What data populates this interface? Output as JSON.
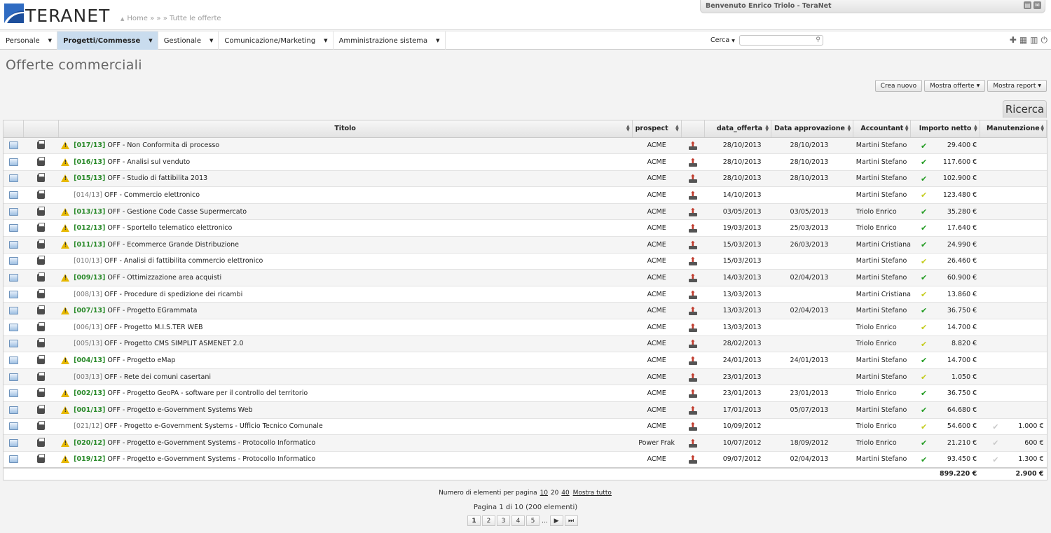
{
  "header": {
    "logo_text": "TERANET",
    "breadcrumb": "Home » » » Tutte le offerte",
    "welcome": "Benvenuto Enrico Triolo - TeraNet"
  },
  "menu": [
    {
      "label": "Personale"
    },
    {
      "label": "Progetti/Commesse",
      "active": true
    },
    {
      "label": "Gestionale"
    },
    {
      "label": "Comunicazione/Marketing"
    },
    {
      "label": "Amministrazione sistema"
    }
  ],
  "search": {
    "label": "Cerca",
    "value": ""
  },
  "page": {
    "title": "Offerte commerciali"
  },
  "actions": {
    "create": "Crea nuovo",
    "show_offers": "Mostra offerte",
    "show_reports": "Mostra report"
  },
  "ricerca_label": "Ricerca",
  "columns": {
    "titolo": "Titolo",
    "prospect": "prospect",
    "data_offerta": "data_offerta",
    "data_approvazione": "Data approvazione",
    "accountant": "Accountant",
    "importo": "Importo netto",
    "manutenzione": "Manutenzione"
  },
  "rows": [
    {
      "code": "[017/13]",
      "title": "OFF - Non Conformita di processo",
      "warn": true,
      "prospect": "ACME",
      "data_offerta": "28/10/2013",
      "data_approvazione": "28/10/2013",
      "accountant": "Martini Stefano",
      "check": "green",
      "importo": "29.400 €",
      "manutenzione": ""
    },
    {
      "code": "[016/13]",
      "title": "OFF - Analisi sul venduto",
      "warn": true,
      "prospect": "ACME",
      "data_offerta": "28/10/2013",
      "data_approvazione": "28/10/2013",
      "accountant": "Martini Stefano",
      "check": "green",
      "importo": "117.600 €",
      "manutenzione": ""
    },
    {
      "code": "[015/13]",
      "title": "OFF - Studio di fattibilita 2013",
      "warn": true,
      "prospect": "ACME",
      "data_offerta": "28/10/2013",
      "data_approvazione": "28/10/2013",
      "accountant": "Martini Stefano",
      "check": "green",
      "importo": "102.900 €",
      "manutenzione": ""
    },
    {
      "code": "[014/13]",
      "title": "OFF - Commercio elettronico",
      "warn": false,
      "prospect": "ACME",
      "data_offerta": "14/10/2013",
      "data_approvazione": "",
      "accountant": "Martini Stefano",
      "check": "yellow",
      "importo": "123.480 €",
      "manutenzione": ""
    },
    {
      "code": "[013/13]",
      "title": "OFF - Gestione Code Casse Supermercato",
      "warn": true,
      "prospect": "ACME",
      "data_offerta": "03/05/2013",
      "data_approvazione": "03/05/2013",
      "accountant": "Triolo Enrico",
      "check": "green",
      "importo": "35.280 €",
      "manutenzione": ""
    },
    {
      "code": "[012/13]",
      "title": "OFF - Sportello telematico elettronico",
      "warn": true,
      "prospect": "ACME",
      "data_offerta": "19/03/2013",
      "data_approvazione": "25/03/2013",
      "accountant": "Triolo Enrico",
      "check": "green",
      "importo": "17.640 €",
      "manutenzione": ""
    },
    {
      "code": "[011/13]",
      "title": "OFF - Ecommerce Grande Distribuzione",
      "warn": true,
      "prospect": "ACME",
      "data_offerta": "15/03/2013",
      "data_approvazione": "26/03/2013",
      "accountant": "Martini Cristiana",
      "check": "green",
      "importo": "24.990 €",
      "manutenzione": ""
    },
    {
      "code": "[010/13]",
      "title": "OFF - Analisi di fattibilita commercio elettronico",
      "warn": false,
      "prospect": "ACME",
      "data_offerta": "15/03/2013",
      "data_approvazione": "",
      "accountant": "Martini Stefano",
      "check": "yellow",
      "importo": "26.460 €",
      "manutenzione": ""
    },
    {
      "code": "[009/13]",
      "title": "OFF - Ottimizzazione area acquisti",
      "warn": true,
      "prospect": "ACME",
      "data_offerta": "14/03/2013",
      "data_approvazione": "02/04/2013",
      "accountant": "Martini Stefano",
      "check": "green",
      "importo": "60.900 €",
      "manutenzione": ""
    },
    {
      "code": "[008/13]",
      "title": "OFF - Procedure di spedizione dei ricambi",
      "warn": false,
      "prospect": "ACME",
      "data_offerta": "13/03/2013",
      "data_approvazione": "",
      "accountant": "Martini Cristiana",
      "check": "yellow",
      "importo": "13.860 €",
      "manutenzione": ""
    },
    {
      "code": "[007/13]",
      "title": "OFF - Progetto EGrammata",
      "warn": true,
      "prospect": "ACME",
      "data_offerta": "13/03/2013",
      "data_approvazione": "02/04/2013",
      "accountant": "Martini Stefano",
      "check": "green",
      "importo": "36.750 €",
      "manutenzione": ""
    },
    {
      "code": "[006/13]",
      "title": "OFF - Progetto M.I.S.TER WEB",
      "warn": false,
      "prospect": "ACME",
      "data_offerta": "13/03/2013",
      "data_approvazione": "",
      "accountant": "Triolo Enrico",
      "check": "yellow",
      "importo": "14.700 €",
      "manutenzione": ""
    },
    {
      "code": "[005/13]",
      "title": "OFF - Progetto CMS SIMPLIT ASMENET 2.0",
      "warn": false,
      "prospect": "ACME",
      "data_offerta": "28/02/2013",
      "data_approvazione": "",
      "accountant": "Triolo Enrico",
      "check": "yellow",
      "importo": "8.820 €",
      "manutenzione": ""
    },
    {
      "code": "[004/13]",
      "title": "OFF - Progetto eMap",
      "warn": true,
      "prospect": "ACME",
      "data_offerta": "24/01/2013",
      "data_approvazione": "24/01/2013",
      "accountant": "Martini Stefano",
      "check": "green",
      "importo": "14.700 €",
      "manutenzione": ""
    },
    {
      "code": "[003/13]",
      "title": "OFF - Rete dei comuni casertani",
      "warn": false,
      "prospect": "ACME",
      "data_offerta": "23/01/2013",
      "data_approvazione": "",
      "accountant": "Martini Stefano",
      "check": "yellow",
      "importo": "1.050 €",
      "manutenzione": ""
    },
    {
      "code": "[002/13]",
      "title": "OFF - Progetto GeoPA - software per il controllo del territorio",
      "warn": true,
      "prospect": "ACME",
      "data_offerta": "23/01/2013",
      "data_approvazione": "23/01/2013",
      "accountant": "Triolo Enrico",
      "check": "green",
      "importo": "36.750 €",
      "manutenzione": ""
    },
    {
      "code": "[001/13]",
      "title": "OFF - Progetto e-Government Systems Web",
      "warn": true,
      "prospect": "ACME",
      "data_offerta": "17/01/2013",
      "data_approvazione": "05/07/2013",
      "accountant": "Martini Stefano",
      "check": "green",
      "importo": "64.680 €",
      "manutenzione": ""
    },
    {
      "code": "[021/12]",
      "title": "OFF - Progetto e-Government Systems - Ufficio Tecnico Comunale",
      "warn": false,
      "prospect": "ACME",
      "data_offerta": "10/09/2012",
      "data_approvazione": "",
      "accountant": "Triolo Enrico",
      "check": "yellow",
      "importo": "54.600 €",
      "manutenzione": "1.000 €"
    },
    {
      "code": "[020/12]",
      "title": "OFF - Progetto e-Government Systems - Protocollo Informatico",
      "warn": true,
      "prospect": "Power Frak",
      "data_offerta": "10/07/2012",
      "data_approvazione": "18/09/2012",
      "accountant": "Triolo Enrico",
      "check": "green",
      "importo": "21.210 €",
      "manutenzione": "600 €"
    },
    {
      "code": "[019/12]",
      "title": "OFF - Progetto e-Government Systems - Protocollo Informatico",
      "warn": true,
      "prospect": "ACME",
      "data_offerta": "09/07/2012",
      "data_approvazione": "02/04/2013",
      "accountant": "Martini Stefano",
      "check": "green",
      "importo": "93.450 €",
      "manutenzione": "1.300 €"
    }
  ],
  "totals": {
    "importo": "899.220 €",
    "manutenzione": "2.900 €"
  },
  "pagination": {
    "per_page_label": "Numero di elementi per pagina",
    "options": [
      "10",
      "20",
      "40"
    ],
    "show_all": "Mostra tutto",
    "info": "Pagina 1 di 10 (200 elementi)",
    "pages": [
      "1",
      "2",
      "3",
      "4",
      "5"
    ],
    "ellipsis": "..."
  }
}
